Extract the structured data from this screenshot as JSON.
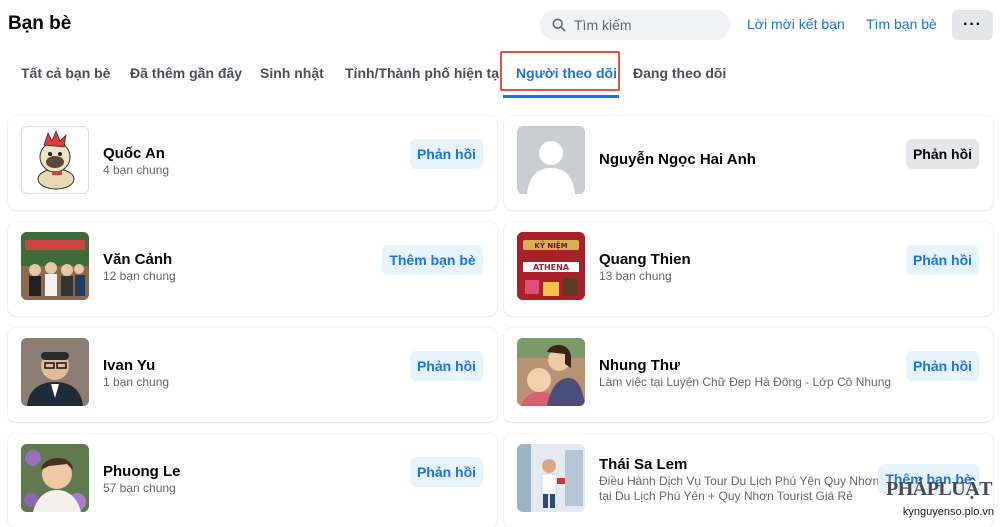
{
  "header": {
    "title": "Bạn bè",
    "search_placeholder": "Tìm kiếm",
    "friend_requests": "Lời mời kết bạn",
    "find_friends": "Tìm bạn bè",
    "more": "···"
  },
  "tabs": [
    {
      "label": "Tất cả bạn bè"
    },
    {
      "label": "Đã thêm gần đây"
    },
    {
      "label": "Sinh nhật"
    },
    {
      "label": "Tỉnh/Thành phố hiện tại"
    },
    {
      "label": "Người theo dõi"
    },
    {
      "label": "Đang theo dõi"
    }
  ],
  "people": [
    {
      "name": "Quốc An",
      "sub": "4 bạn chung",
      "action": "Phản hồi"
    },
    {
      "name": "Nguyễn Ngọc Hai Anh",
      "sub": "",
      "action": "Phản hồi"
    },
    {
      "name": "Văn Cảnh",
      "sub": "12 bạn chung",
      "action": "Thêm bạn bè"
    },
    {
      "name": "Quang Thien",
      "sub": "13 bạn chung",
      "action": "Phản hồi"
    },
    {
      "name": "Ivan Yu",
      "sub": "1 bạn chung",
      "action": "Phản hồi"
    },
    {
      "name": "Nhung Thư",
      "sub": "Làm việc tại Luyện Chữ Đẹp Hà Đông - Lớp Cô Nhung",
      "action": "Phản hồi"
    },
    {
      "name": "Phuong Le",
      "sub": "57 bạn chung",
      "action": "Phản hồi"
    },
    {
      "name": "Thái Sa Lem",
      "sub": "Điều Hành Dịch Vụ Tour Du Lịch Phú Yên Quy Nhơn",
      "sub2": "tại Du Lịch Phú Yên + Quy Nhơn Tourist Giá Rẻ",
      "action": "Thêm bạn bè"
    }
  ],
  "athena_poster": {
    "line1": "KỶ NIỆM",
    "line2": "ATHENA"
  },
  "watermark": {
    "logo": "PHÁPLUẬT",
    "url": "kynguyenso.plo.vn"
  },
  "colors": {
    "accent": "#1b74e4",
    "active_box": "#e0573d",
    "secondary_btn": "#e7f3ff"
  }
}
